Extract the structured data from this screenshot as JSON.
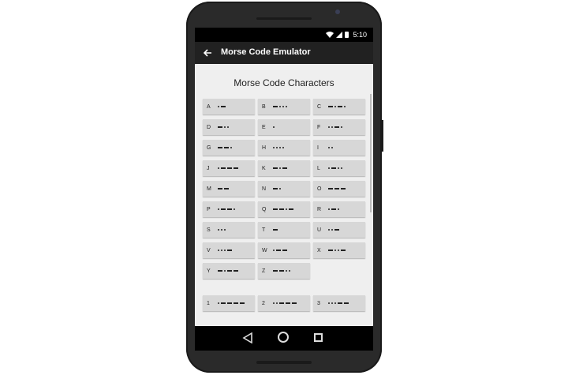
{
  "status_bar": {
    "time": "5:10"
  },
  "app_bar": {
    "title": "Morse Code Emulator",
    "back_icon": "arrow-back-icon"
  },
  "content": {
    "section_title": "Morse Code Characters",
    "letters": [
      {
        "char": "A",
        "code": ".-"
      },
      {
        "char": "B",
        "code": "-..."
      },
      {
        "char": "C",
        "code": "-.-."
      },
      {
        "char": "D",
        "code": "-.."
      },
      {
        "char": "E",
        "code": "."
      },
      {
        "char": "F",
        "code": "..-."
      },
      {
        "char": "G",
        "code": "--."
      },
      {
        "char": "H",
        "code": "...."
      },
      {
        "char": "I",
        "code": ".."
      },
      {
        "char": "J",
        "code": ".---"
      },
      {
        "char": "K",
        "code": "-.-"
      },
      {
        "char": "L",
        "code": ".-.."
      },
      {
        "char": "M",
        "code": "--"
      },
      {
        "char": "N",
        "code": "-."
      },
      {
        "char": "O",
        "code": "---"
      },
      {
        "char": "P",
        "code": ".--."
      },
      {
        "char": "Q",
        "code": "--.-"
      },
      {
        "char": "R",
        "code": ".-."
      },
      {
        "char": "S",
        "code": "..."
      },
      {
        "char": "T",
        "code": "-"
      },
      {
        "char": "U",
        "code": "..-"
      },
      {
        "char": "V",
        "code": "...-"
      },
      {
        "char": "W",
        "code": ".--"
      },
      {
        "char": "X",
        "code": "-..-"
      },
      {
        "char": "Y",
        "code": "-.--"
      },
      {
        "char": "Z",
        "code": "--.."
      }
    ],
    "numbers": [
      {
        "char": "1",
        "code": ".----"
      },
      {
        "char": "2",
        "code": "..---"
      },
      {
        "char": "3",
        "code": "...--"
      }
    ]
  },
  "nav_bar": {
    "back": "nav-back-icon",
    "home": "nav-home-icon",
    "recent": "nav-recents-icon"
  },
  "colors": {
    "app_bar": "#212121",
    "key_bg": "#d7d7d7",
    "content_bg": "#efefef"
  }
}
